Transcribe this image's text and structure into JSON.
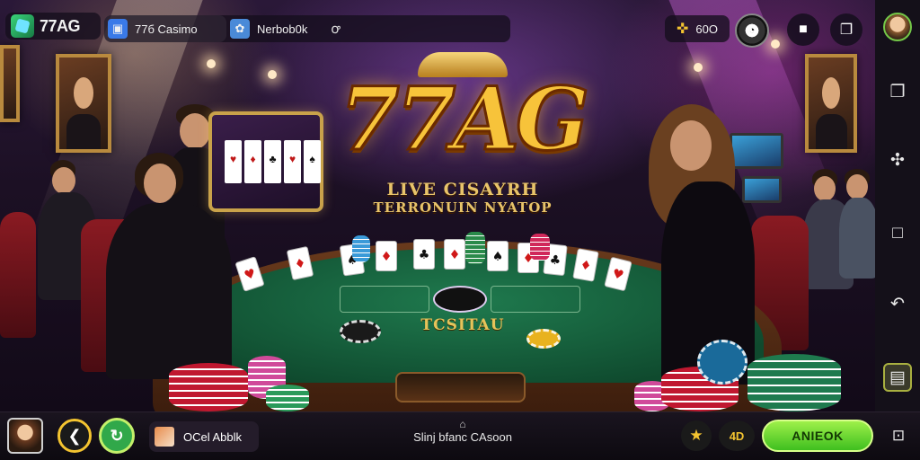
{
  "topbar": {
    "brand_label": "77AG",
    "tabs": [
      {
        "label": "77б Casimo",
        "icon": "browser-icon"
      },
      {
        "label": "Nerbob0k",
        "icon": "translate-icon"
      }
    ],
    "extra_glyph": "ꝍ",
    "coins_value": "60O",
    "avatar": "user-avatar"
  },
  "hero": {
    "logo_text": "77AG",
    "tagline_line1": "LIVE CISAYRH",
    "tagline_line2": "TERRONUIN NYATOP",
    "felt_label": "TCSITAU"
  },
  "siderail": {
    "items": [
      "copy-icon",
      "puzzle-icon",
      "square-icon",
      "back-gesture-icon",
      "screenshot-icon"
    ]
  },
  "bottombar": {
    "table_chip_label": "OCel Abblk",
    "lobby_caret": "⌂",
    "lobby_label": "Slinj bfanc CAsoon",
    "level_label": "4D",
    "action_label": "ANIEOK"
  },
  "colors": {
    "accent_gold": "#f4c430",
    "action_green": "#3fbf1f",
    "felt_green": "#1f7a4e"
  }
}
